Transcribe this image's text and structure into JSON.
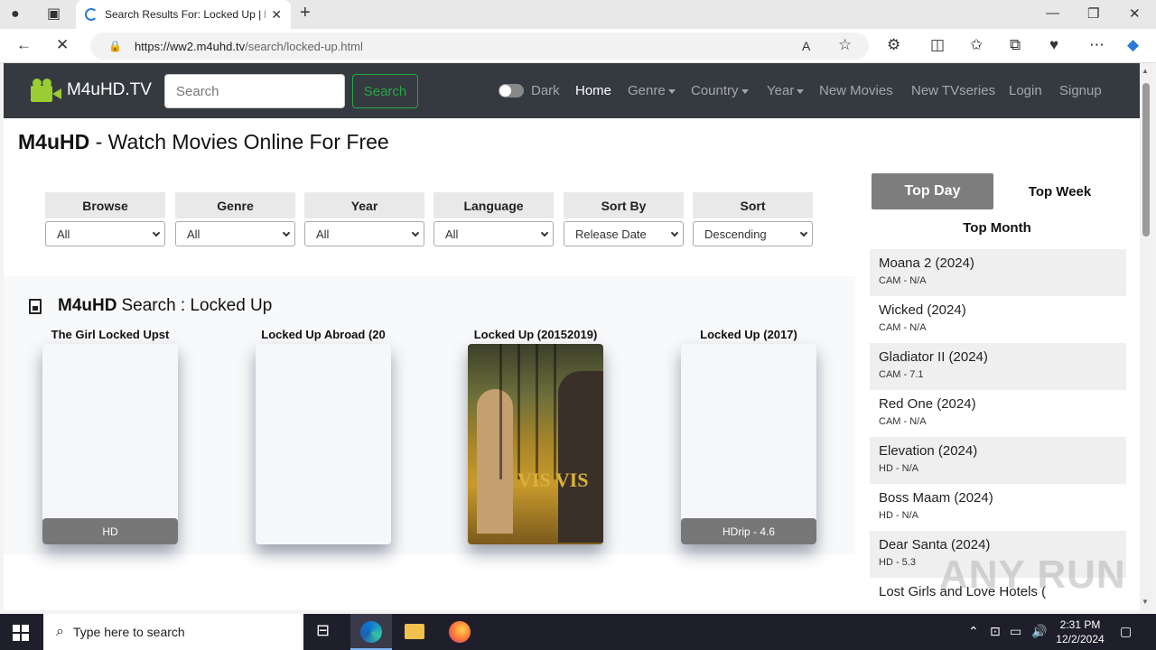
{
  "browser": {
    "tab_title": "Search Results For: Locked Up | M",
    "url_domain": "https://ww2.m4uhd.tv",
    "url_path": "/search/locked-up.html"
  },
  "navbar": {
    "brand": "M4uHD.TV",
    "search_placeholder": "Search",
    "search_button": "Search",
    "dark_label": "Dark",
    "links": [
      "Home",
      "Genre",
      "Country",
      "Year",
      "New Movies",
      "New TVseries",
      "Login",
      "Signup"
    ]
  },
  "page_title": {
    "bold": "M4uHD",
    "rest": " - Watch Movies Online For Free"
  },
  "filters": [
    {
      "label": "Browse",
      "value": "All"
    },
    {
      "label": "Genre",
      "value": "All"
    },
    {
      "label": "Year",
      "value": "All"
    },
    {
      "label": "Language",
      "value": "All"
    },
    {
      "label": "Sort By",
      "value": "Release Date"
    },
    {
      "label": "Sort",
      "value": "Descending"
    }
  ],
  "results": {
    "heading_bold": "M4uHD",
    "heading_rest": "Search : Locked Up",
    "movies": [
      {
        "title": "The Girl Locked Upst",
        "quality": "HD"
      },
      {
        "title": "Locked Up Abroad (20",
        "quality": ""
      },
      {
        "title": "Locked Up (20152019)",
        "quality": ""
      },
      {
        "title": "Locked Up (2017)",
        "quality": "HDrip - 4.6"
      }
    ],
    "poster_text": "VIS VIS"
  },
  "sidebar": {
    "tab_day": "Top Day",
    "tab_week": "Top Week",
    "tab_month": "Top Month",
    "items": [
      {
        "name": "Moana 2 (2024)",
        "meta": "CAM - N/A"
      },
      {
        "name": "Wicked (2024)",
        "meta": "CAM - N/A"
      },
      {
        "name": "Gladiator II (2024)",
        "meta": "CAM - 7.1"
      },
      {
        "name": "Red One (2024)",
        "meta": "CAM - N/A"
      },
      {
        "name": "Elevation (2024)",
        "meta": "HD - N/A"
      },
      {
        "name": "Boss Maam (2024)",
        "meta": "HD - N/A"
      },
      {
        "name": "Dear Santa (2024)",
        "meta": "HD - 5.3"
      },
      {
        "name": "Lost Girls and Love Hotels (",
        "meta": ""
      }
    ]
  },
  "watermark": "ANY RUN",
  "taskbar": {
    "search_text": "Type here to search",
    "time": "2:31 PM",
    "date": "12/2/2024"
  },
  "colors": {
    "navbar_bg": "#343a40",
    "brand_icon": "#9acd32",
    "search_green": "#28a745"
  }
}
